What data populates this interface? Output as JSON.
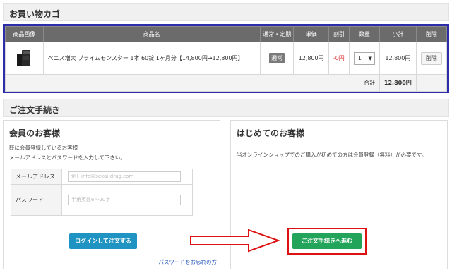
{
  "cart": {
    "title": "お買い物カゴ",
    "headers": [
      "商品画像",
      "商品名",
      "通常・定期",
      "単価",
      "割引",
      "数量",
      "小計",
      "削除"
    ],
    "item": {
      "name": "ペニス増大 プライムモンスター 1本 60錠 1ヶ月分【14,800円→12,800円】",
      "type": "通常",
      "unit_price": "12,800円",
      "discount": "-0円",
      "quantity": "1",
      "subtotal": "12,800円",
      "delete_label": "削除"
    },
    "total_label": "合計",
    "total_value": "12,800円",
    "highlight_color": "#2c2ca8"
  },
  "checkout": {
    "title": "ご注文手続き",
    "member": {
      "heading": "会員のお客様",
      "desc1": "既に会員登録しているお客様",
      "desc2": "メールアドレスとパスワードを入力して下さい。",
      "email_label": "メールアドレス",
      "email_placeholder": "例）info@sekai-drug.com",
      "password_label": "パスワード",
      "password_placeholder": "半角英数6～20字",
      "login_button": "ログインして注文する",
      "forgot_link": "パスワードをお忘れの方"
    },
    "new": {
      "heading": "はじめてのお客様",
      "desc": "当オンラインショップでのご購入が初めての方は会員登録（無料）が必要です。",
      "next_button": "ご注文手続きへ進む"
    }
  },
  "colors": {
    "login_button": "#1f93c2",
    "next_button": "#22a55a",
    "annotation_red": "#d11"
  }
}
